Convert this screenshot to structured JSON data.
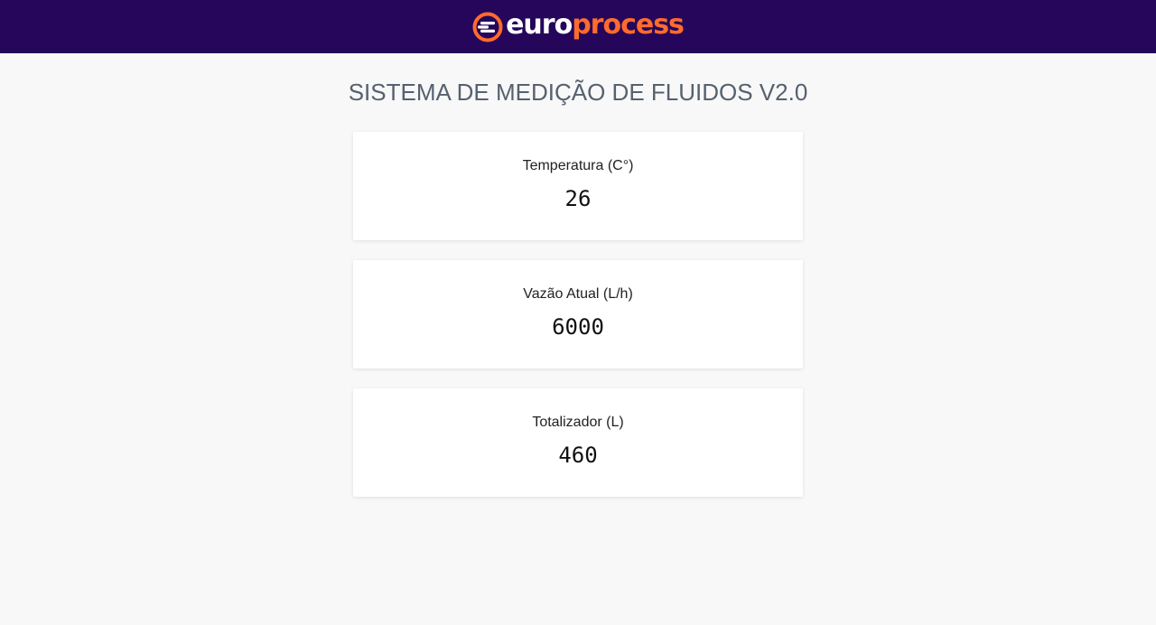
{
  "header": {
    "logo": {
      "part1": "euro",
      "part2": "process",
      "icon": "europrocess-logo-icon"
    }
  },
  "page": {
    "title": "SISTEMA DE MEDIÇÃO DE FLUIDOS V2.0"
  },
  "cards": [
    {
      "label": "Temperatura (C°)",
      "value": "26"
    },
    {
      "label": "Vazão Atual (L/h)",
      "value": "6000"
    },
    {
      "label": "Totalizador (L)",
      "value": "460"
    }
  ],
  "colors": {
    "header_bg": "#25065b",
    "brand_orange": "#ff6b2c",
    "page_bg": "#f8f8f8",
    "title_text": "#56616f"
  }
}
